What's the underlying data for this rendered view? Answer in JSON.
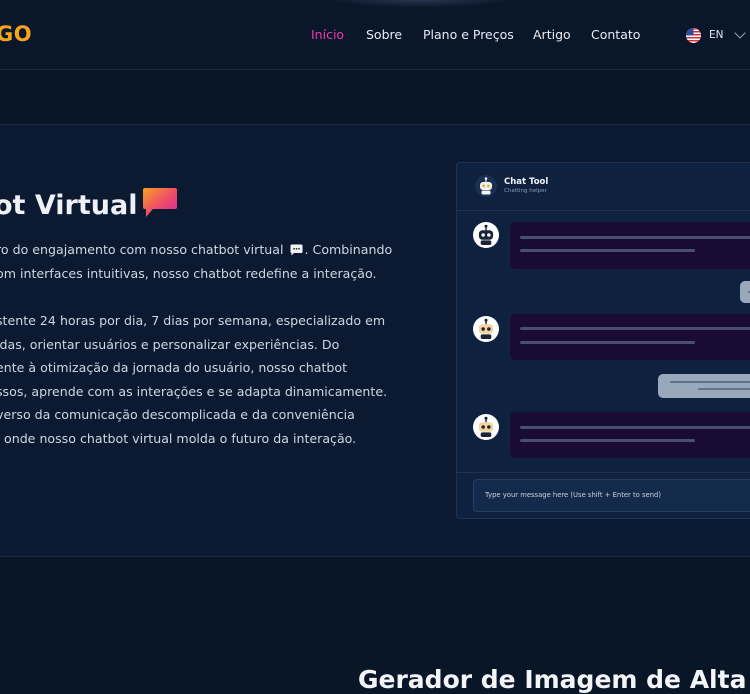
{
  "header": {
    "logo": "GO",
    "nav": [
      {
        "label": "Início",
        "active": true
      },
      {
        "label": "Sobre",
        "active": false
      },
      {
        "label": "Plano e Preços",
        "active": false
      },
      {
        "label": "Artigo",
        "active": false
      },
      {
        "label": "Contato",
        "active": false
      }
    ],
    "language": "EN"
  },
  "hero": {
    "title": "ot Virtual",
    "paragraph1": [
      "ro do engajamento com nosso chatbot virtual",
      ". Combinando",
      "om interfaces intuitivas, nosso chatbot redefine a interação."
    ],
    "paragraph2": [
      "stente 24 horas por dia, 7 dias por semana, especializado em",
      "idas, orientar usuários e personalizar experiências. Do",
      "ente à otimização da jornada do usuário, nosso chatbot",
      "ssos, aprende com as interações e se adapta dinamicamente.",
      "verso da comunicação descomplicada e da conveniência",
      ", onde nosso chatbot virtual molda o futuro da interação."
    ]
  },
  "chat": {
    "name": "Chat Tool",
    "subtitle": "Chatting helper",
    "input_placeholder": "Type your message here (Use shift + Enter to send)"
  },
  "next_section": {
    "title": "Gerador de Imagem de Alta"
  },
  "colors": {
    "accent": "#ec3ba7",
    "logo": "#f4a51c",
    "background": "#091628"
  },
  "icons": [
    "us-flag-icon",
    "chevron-down-icon",
    "chat-bubble-icon",
    "robot-icon"
  ]
}
